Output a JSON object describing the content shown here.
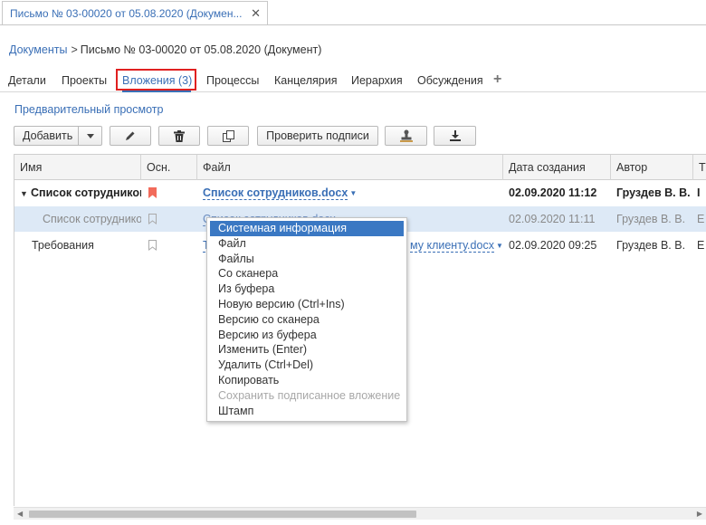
{
  "doc_tab": {
    "title": "Письмо № 03-00020 от 05.08.2020 (Докумен...",
    "close": "✕"
  },
  "breadcrumb": {
    "root": "Документы",
    "separator": ">",
    "current": "Письмо № 03-00020 от 05.08.2020 (Документ)"
  },
  "tabs": [
    {
      "label": "Детали"
    },
    {
      "label": "Проекты"
    },
    {
      "label": "Вложения (3)",
      "active": true
    },
    {
      "label": "Процессы"
    },
    {
      "label": "Канцелярия"
    },
    {
      "label": "Иерархия"
    },
    {
      "label": "Обсуждения"
    }
  ],
  "tab_add": "+",
  "preview_link": "Предварительный просмотр",
  "toolbar": {
    "add_label": "Добавить",
    "check_signatures_label": "Проверить подписи",
    "icons": [
      "pencil-icon",
      "trash-icon",
      "copy-icon",
      "stamp-icon",
      "download-icon"
    ]
  },
  "grid": {
    "columns": [
      "Имя",
      "Осн.",
      "Файл",
      "Дата создания",
      "Автор",
      "Т"
    ],
    "rows": [
      {
        "name": "Список сотрудников",
        "main": true,
        "file": "Список сотрудников.docx",
        "created": "02.09.2020 11:12",
        "author": "Груздев В. В.",
        "extra": "I",
        "bold": true,
        "expanded": true
      },
      {
        "name": "Список сотрудников",
        "main": false,
        "file": "Список сотрудников.docx",
        "created": "02.09.2020 11:11",
        "author": "Груздев В. В.",
        "extra": "E",
        "selected": true
      },
      {
        "name": "Требования",
        "main": false,
        "file": "Т",
        "file_tail": "му клиенту.docx",
        "created": "02.09.2020 09:25",
        "author": "Груздев В. В.",
        "extra": "E"
      }
    ]
  },
  "context_menu": {
    "items": [
      {
        "label": "Системная информация",
        "selected": true
      },
      {
        "label": "Файл"
      },
      {
        "label": "Файлы"
      },
      {
        "label": "Со сканера"
      },
      {
        "label": "Из буфера"
      },
      {
        "label": "Новую версию (Ctrl+Ins)"
      },
      {
        "label": "Версию со сканера"
      },
      {
        "label": "Версию из буфера"
      },
      {
        "label": "Изменить (Enter)"
      },
      {
        "label": "Удалить (Ctrl+Del)"
      },
      {
        "label": "Копировать"
      },
      {
        "label": "Сохранить подписанное вложение",
        "disabled": true
      },
      {
        "label": "Штамп"
      }
    ]
  },
  "colors": {
    "link": "#3a6fb6",
    "highlight_box": "#e02020",
    "menu_selected": "#3a78c3",
    "row_selected": "#dde9f6",
    "flag": "#f26b5b"
  }
}
